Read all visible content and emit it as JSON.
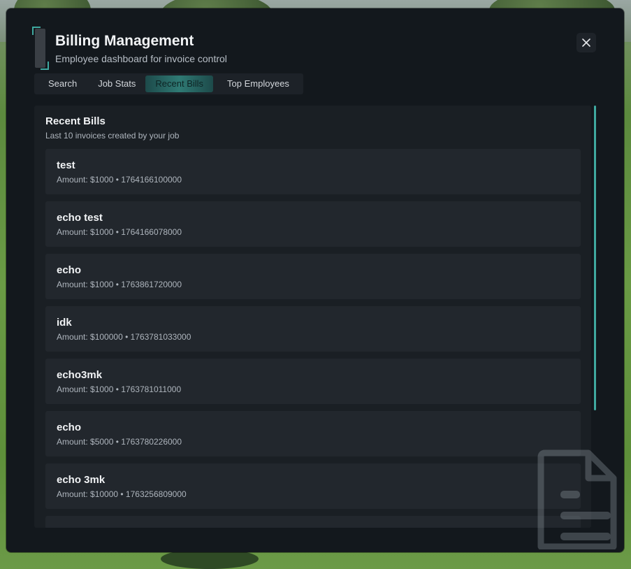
{
  "header": {
    "title": "Billing Management",
    "subtitle": "Employee dashboard for invoice control",
    "close_icon": "close-icon"
  },
  "tabs": [
    {
      "label": "Search",
      "active": false
    },
    {
      "label": "Job Stats",
      "active": false
    },
    {
      "label": "Recent Bills",
      "active": true
    },
    {
      "label": "Top Employees",
      "active": false
    }
  ],
  "section": {
    "title": "Recent Bills",
    "subtitle": "Last 10 invoices created by your job"
  },
  "bills": [
    {
      "name": "test",
      "meta": "Amount: $1000 • 1764166100000"
    },
    {
      "name": "echo test",
      "meta": "Amount: $1000 • 1764166078000"
    },
    {
      "name": "echo",
      "meta": "Amount: $1000 • 1763861720000"
    },
    {
      "name": "idk",
      "meta": "Amount: $100000 • 1763781033000"
    },
    {
      "name": "echo3mk",
      "meta": "Amount: $1000 • 1763781011000"
    },
    {
      "name": "echo",
      "meta": "Amount: $5000 • 1763780226000"
    },
    {
      "name": "echo 3mk",
      "meta": "Amount: $10000 • 1763256809000"
    },
    {
      "name": "",
      "meta": ""
    }
  ],
  "colors": {
    "accent": "#3fa9a0",
    "panel": "#13181d",
    "card": "#22272d"
  },
  "decor_icon": "document-icon"
}
